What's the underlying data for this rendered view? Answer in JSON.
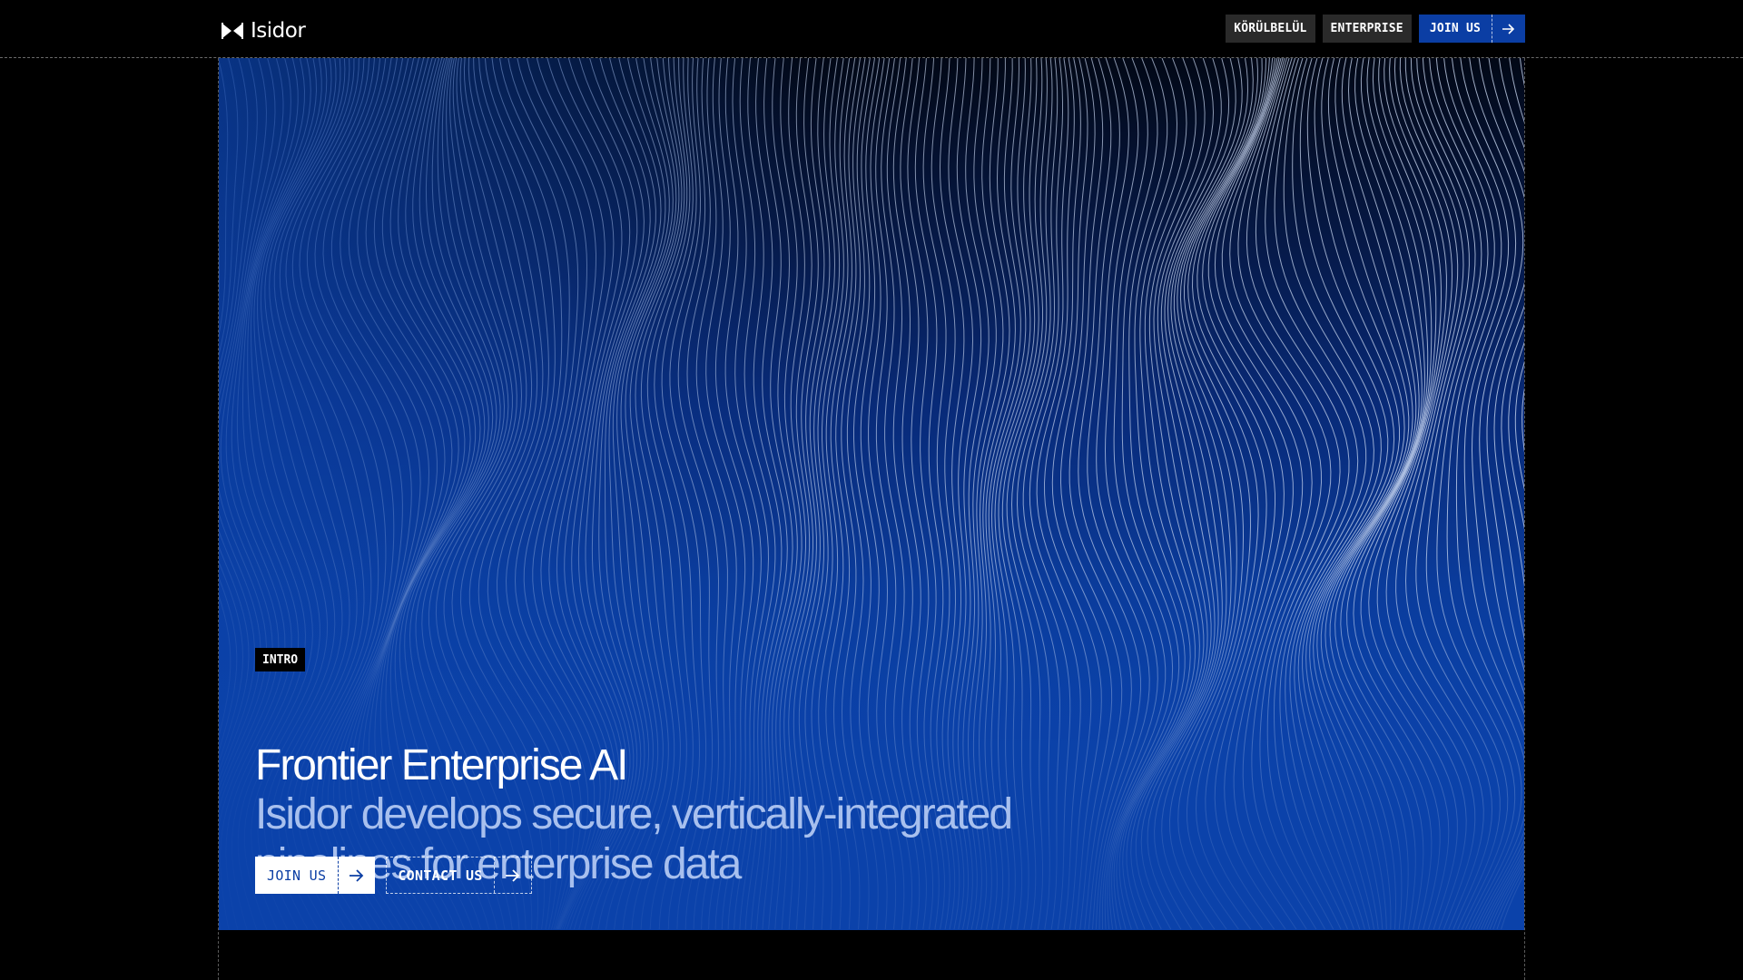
{
  "brand": {
    "name": "Isidor",
    "logo_icon": "bowtie-logo-icon"
  },
  "nav": {
    "items": [
      {
        "label": "KÖRÜLBELÜL"
      },
      {
        "label": "ENTERPRISE"
      }
    ],
    "join_label": "JOIN US",
    "join_icon": "arrow-right-icon"
  },
  "hero": {
    "badge": "INTRO",
    "title": "Frontier Enterprise AI",
    "subtitle": "Isidor develops secure, vertically-integrated pipelines for enterprise data",
    "cta_primary": "JOIN US",
    "cta_secondary": "CONTACT US",
    "cta_icon": "arrow-right-icon"
  },
  "colors": {
    "background": "#000000",
    "accent": "#0b3ea4",
    "subtitle": "#a8c0ee",
    "nav_button": "#2a2a2a"
  }
}
